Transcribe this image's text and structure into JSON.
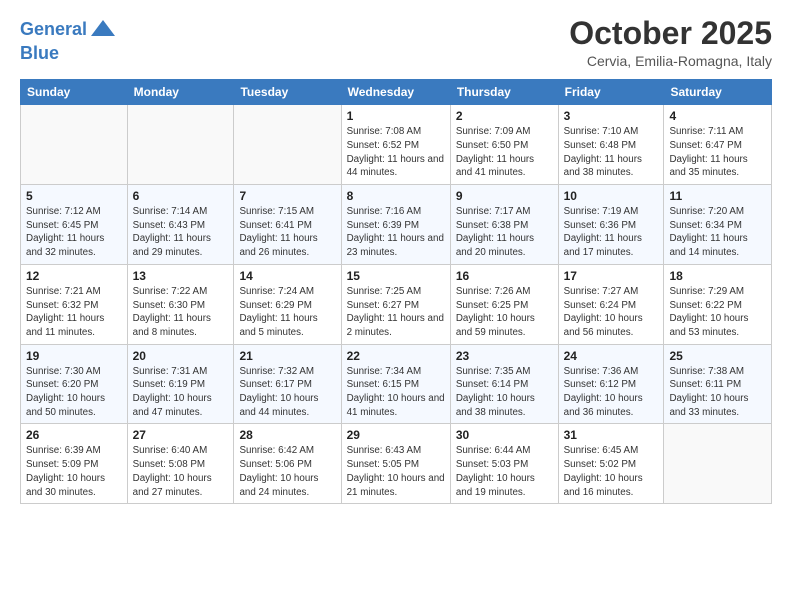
{
  "header": {
    "logo_line1": "General",
    "logo_line2": "Blue",
    "month": "October 2025",
    "location": "Cervia, Emilia-Romagna, Italy"
  },
  "days_of_week": [
    "Sunday",
    "Monday",
    "Tuesday",
    "Wednesday",
    "Thursday",
    "Friday",
    "Saturday"
  ],
  "weeks": [
    [
      {
        "day": "",
        "info": ""
      },
      {
        "day": "",
        "info": ""
      },
      {
        "day": "",
        "info": ""
      },
      {
        "day": "1",
        "info": "Sunrise: 7:08 AM\nSunset: 6:52 PM\nDaylight: 11 hours and 44 minutes."
      },
      {
        "day": "2",
        "info": "Sunrise: 7:09 AM\nSunset: 6:50 PM\nDaylight: 11 hours and 41 minutes."
      },
      {
        "day": "3",
        "info": "Sunrise: 7:10 AM\nSunset: 6:48 PM\nDaylight: 11 hours and 38 minutes."
      },
      {
        "day": "4",
        "info": "Sunrise: 7:11 AM\nSunset: 6:47 PM\nDaylight: 11 hours and 35 minutes."
      }
    ],
    [
      {
        "day": "5",
        "info": "Sunrise: 7:12 AM\nSunset: 6:45 PM\nDaylight: 11 hours and 32 minutes."
      },
      {
        "day": "6",
        "info": "Sunrise: 7:14 AM\nSunset: 6:43 PM\nDaylight: 11 hours and 29 minutes."
      },
      {
        "day": "7",
        "info": "Sunrise: 7:15 AM\nSunset: 6:41 PM\nDaylight: 11 hours and 26 minutes."
      },
      {
        "day": "8",
        "info": "Sunrise: 7:16 AM\nSunset: 6:39 PM\nDaylight: 11 hours and 23 minutes."
      },
      {
        "day": "9",
        "info": "Sunrise: 7:17 AM\nSunset: 6:38 PM\nDaylight: 11 hours and 20 minutes."
      },
      {
        "day": "10",
        "info": "Sunrise: 7:19 AM\nSunset: 6:36 PM\nDaylight: 11 hours and 17 minutes."
      },
      {
        "day": "11",
        "info": "Sunrise: 7:20 AM\nSunset: 6:34 PM\nDaylight: 11 hours and 14 minutes."
      }
    ],
    [
      {
        "day": "12",
        "info": "Sunrise: 7:21 AM\nSunset: 6:32 PM\nDaylight: 11 hours and 11 minutes."
      },
      {
        "day": "13",
        "info": "Sunrise: 7:22 AM\nSunset: 6:30 PM\nDaylight: 11 hours and 8 minutes."
      },
      {
        "day": "14",
        "info": "Sunrise: 7:24 AM\nSunset: 6:29 PM\nDaylight: 11 hours and 5 minutes."
      },
      {
        "day": "15",
        "info": "Sunrise: 7:25 AM\nSunset: 6:27 PM\nDaylight: 11 hours and 2 minutes."
      },
      {
        "day": "16",
        "info": "Sunrise: 7:26 AM\nSunset: 6:25 PM\nDaylight: 10 hours and 59 minutes."
      },
      {
        "day": "17",
        "info": "Sunrise: 7:27 AM\nSunset: 6:24 PM\nDaylight: 10 hours and 56 minutes."
      },
      {
        "day": "18",
        "info": "Sunrise: 7:29 AM\nSunset: 6:22 PM\nDaylight: 10 hours and 53 minutes."
      }
    ],
    [
      {
        "day": "19",
        "info": "Sunrise: 7:30 AM\nSunset: 6:20 PM\nDaylight: 10 hours and 50 minutes."
      },
      {
        "day": "20",
        "info": "Sunrise: 7:31 AM\nSunset: 6:19 PM\nDaylight: 10 hours and 47 minutes."
      },
      {
        "day": "21",
        "info": "Sunrise: 7:32 AM\nSunset: 6:17 PM\nDaylight: 10 hours and 44 minutes."
      },
      {
        "day": "22",
        "info": "Sunrise: 7:34 AM\nSunset: 6:15 PM\nDaylight: 10 hours and 41 minutes."
      },
      {
        "day": "23",
        "info": "Sunrise: 7:35 AM\nSunset: 6:14 PM\nDaylight: 10 hours and 38 minutes."
      },
      {
        "day": "24",
        "info": "Sunrise: 7:36 AM\nSunset: 6:12 PM\nDaylight: 10 hours and 36 minutes."
      },
      {
        "day": "25",
        "info": "Sunrise: 7:38 AM\nSunset: 6:11 PM\nDaylight: 10 hours and 33 minutes."
      }
    ],
    [
      {
        "day": "26",
        "info": "Sunrise: 6:39 AM\nSunset: 5:09 PM\nDaylight: 10 hours and 30 minutes."
      },
      {
        "day": "27",
        "info": "Sunrise: 6:40 AM\nSunset: 5:08 PM\nDaylight: 10 hours and 27 minutes."
      },
      {
        "day": "28",
        "info": "Sunrise: 6:42 AM\nSunset: 5:06 PM\nDaylight: 10 hours and 24 minutes."
      },
      {
        "day": "29",
        "info": "Sunrise: 6:43 AM\nSunset: 5:05 PM\nDaylight: 10 hours and 21 minutes."
      },
      {
        "day": "30",
        "info": "Sunrise: 6:44 AM\nSunset: 5:03 PM\nDaylight: 10 hours and 19 minutes."
      },
      {
        "day": "31",
        "info": "Sunrise: 6:45 AM\nSunset: 5:02 PM\nDaylight: 10 hours and 16 minutes."
      },
      {
        "day": "",
        "info": ""
      }
    ]
  ]
}
